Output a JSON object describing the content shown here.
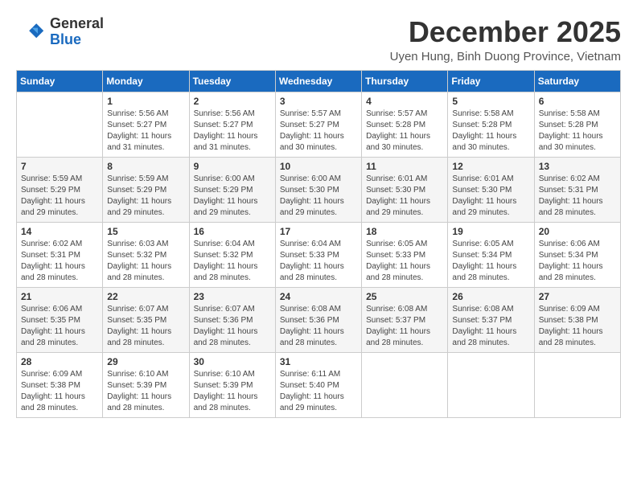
{
  "logo": {
    "general": "General",
    "blue": "Blue"
  },
  "header": {
    "month_title": "December 2025",
    "location": "Uyen Hung, Binh Duong Province, Vietnam"
  },
  "weekdays": [
    "Sunday",
    "Monday",
    "Tuesday",
    "Wednesday",
    "Thursday",
    "Friday",
    "Saturday"
  ],
  "weeks": [
    [
      {
        "day": "",
        "info": ""
      },
      {
        "day": "1",
        "info": "Sunrise: 5:56 AM\nSunset: 5:27 PM\nDaylight: 11 hours and 31 minutes."
      },
      {
        "day": "2",
        "info": "Sunrise: 5:56 AM\nSunset: 5:27 PM\nDaylight: 11 hours and 31 minutes."
      },
      {
        "day": "3",
        "info": "Sunrise: 5:57 AM\nSunset: 5:27 PM\nDaylight: 11 hours and 30 minutes."
      },
      {
        "day": "4",
        "info": "Sunrise: 5:57 AM\nSunset: 5:28 PM\nDaylight: 11 hours and 30 minutes."
      },
      {
        "day": "5",
        "info": "Sunrise: 5:58 AM\nSunset: 5:28 PM\nDaylight: 11 hours and 30 minutes."
      },
      {
        "day": "6",
        "info": "Sunrise: 5:58 AM\nSunset: 5:28 PM\nDaylight: 11 hours and 30 minutes."
      }
    ],
    [
      {
        "day": "7",
        "info": "Sunrise: 5:59 AM\nSunset: 5:29 PM\nDaylight: 11 hours and 29 minutes."
      },
      {
        "day": "8",
        "info": "Sunrise: 5:59 AM\nSunset: 5:29 PM\nDaylight: 11 hours and 29 minutes."
      },
      {
        "day": "9",
        "info": "Sunrise: 6:00 AM\nSunset: 5:29 PM\nDaylight: 11 hours and 29 minutes."
      },
      {
        "day": "10",
        "info": "Sunrise: 6:00 AM\nSunset: 5:30 PM\nDaylight: 11 hours and 29 minutes."
      },
      {
        "day": "11",
        "info": "Sunrise: 6:01 AM\nSunset: 5:30 PM\nDaylight: 11 hours and 29 minutes."
      },
      {
        "day": "12",
        "info": "Sunrise: 6:01 AM\nSunset: 5:30 PM\nDaylight: 11 hours and 29 minutes."
      },
      {
        "day": "13",
        "info": "Sunrise: 6:02 AM\nSunset: 5:31 PM\nDaylight: 11 hours and 28 minutes."
      }
    ],
    [
      {
        "day": "14",
        "info": "Sunrise: 6:02 AM\nSunset: 5:31 PM\nDaylight: 11 hours and 28 minutes."
      },
      {
        "day": "15",
        "info": "Sunrise: 6:03 AM\nSunset: 5:32 PM\nDaylight: 11 hours and 28 minutes."
      },
      {
        "day": "16",
        "info": "Sunrise: 6:04 AM\nSunset: 5:32 PM\nDaylight: 11 hours and 28 minutes."
      },
      {
        "day": "17",
        "info": "Sunrise: 6:04 AM\nSunset: 5:33 PM\nDaylight: 11 hours and 28 minutes."
      },
      {
        "day": "18",
        "info": "Sunrise: 6:05 AM\nSunset: 5:33 PM\nDaylight: 11 hours and 28 minutes."
      },
      {
        "day": "19",
        "info": "Sunrise: 6:05 AM\nSunset: 5:34 PM\nDaylight: 11 hours and 28 minutes."
      },
      {
        "day": "20",
        "info": "Sunrise: 6:06 AM\nSunset: 5:34 PM\nDaylight: 11 hours and 28 minutes."
      }
    ],
    [
      {
        "day": "21",
        "info": "Sunrise: 6:06 AM\nSunset: 5:35 PM\nDaylight: 11 hours and 28 minutes."
      },
      {
        "day": "22",
        "info": "Sunrise: 6:07 AM\nSunset: 5:35 PM\nDaylight: 11 hours and 28 minutes."
      },
      {
        "day": "23",
        "info": "Sunrise: 6:07 AM\nSunset: 5:36 PM\nDaylight: 11 hours and 28 minutes."
      },
      {
        "day": "24",
        "info": "Sunrise: 6:08 AM\nSunset: 5:36 PM\nDaylight: 11 hours and 28 minutes."
      },
      {
        "day": "25",
        "info": "Sunrise: 6:08 AM\nSunset: 5:37 PM\nDaylight: 11 hours and 28 minutes."
      },
      {
        "day": "26",
        "info": "Sunrise: 6:08 AM\nSunset: 5:37 PM\nDaylight: 11 hours and 28 minutes."
      },
      {
        "day": "27",
        "info": "Sunrise: 6:09 AM\nSunset: 5:38 PM\nDaylight: 11 hours and 28 minutes."
      }
    ],
    [
      {
        "day": "28",
        "info": "Sunrise: 6:09 AM\nSunset: 5:38 PM\nDaylight: 11 hours and 28 minutes."
      },
      {
        "day": "29",
        "info": "Sunrise: 6:10 AM\nSunset: 5:39 PM\nDaylight: 11 hours and 28 minutes."
      },
      {
        "day": "30",
        "info": "Sunrise: 6:10 AM\nSunset: 5:39 PM\nDaylight: 11 hours and 28 minutes."
      },
      {
        "day": "31",
        "info": "Sunrise: 6:11 AM\nSunset: 5:40 PM\nDaylight: 11 hours and 29 minutes."
      },
      {
        "day": "",
        "info": ""
      },
      {
        "day": "",
        "info": ""
      },
      {
        "day": "",
        "info": ""
      }
    ]
  ]
}
